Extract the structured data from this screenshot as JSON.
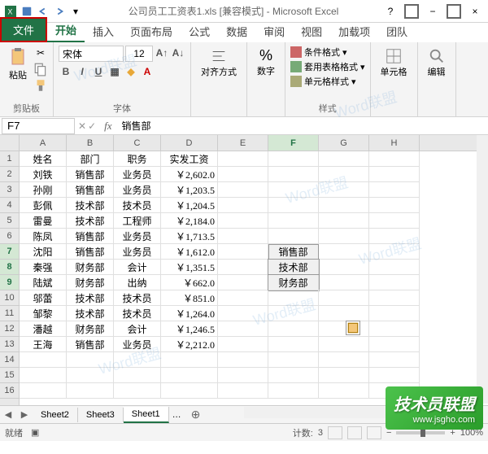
{
  "title": "公司员工工资表1.xls [兼容模式] - Microsoft Excel",
  "ribbon": {
    "file": "文件",
    "tabs": [
      "开始",
      "插入",
      "页面布局",
      "公式",
      "数据",
      "审阅",
      "视图",
      "加载项",
      "团队"
    ],
    "active_tab": 0,
    "clipboard": {
      "paste": "粘贴",
      "label": "剪贴板"
    },
    "font": {
      "name": "宋体",
      "size": "12",
      "label": "字体"
    },
    "align": {
      "label": "对齐方式"
    },
    "number": {
      "label": "数字",
      "pct": "%"
    },
    "styles": {
      "cond": "条件格式",
      "table": "套用表格格式",
      "cell": "单元格样式",
      "label": "样式"
    },
    "cells": {
      "label": "单元格"
    },
    "editing": {
      "label": "编辑"
    }
  },
  "name_box": "F7",
  "formula": "销售部",
  "columns": [
    "A",
    "B",
    "C",
    "D",
    "E",
    "F",
    "G",
    "H"
  ],
  "selected_col": "F",
  "selected_rows": [
    7,
    8,
    9
  ],
  "header_row": [
    "姓名",
    "部门",
    "职务",
    "实发工资"
  ],
  "rows": [
    [
      "刘铁",
      "销售部",
      "业务员",
      "￥2,602.0"
    ],
    [
      "孙刚",
      "销售部",
      "业务员",
      "￥1,203.5"
    ],
    [
      "彭佩",
      "技术部",
      "技术员",
      "￥1,204.5"
    ],
    [
      "雷曼",
      "技术部",
      "工程师",
      "￥2,184.0"
    ],
    [
      "陈凤",
      "销售部",
      "业务员",
      "￥1,713.5"
    ],
    [
      "沈阳",
      "销售部",
      "业务员",
      "￥1,612.0"
    ],
    [
      "秦强",
      "财务部",
      "会计",
      "￥1,351.5"
    ],
    [
      "陆斌",
      "财务部",
      "出纳",
      "￥662.0"
    ],
    [
      "邬蕾",
      "技术部",
      "技术员",
      "￥851.0"
    ],
    [
      "邹黎",
      "技术部",
      "技术员",
      "￥1,264.0"
    ],
    [
      "潘越",
      "财务部",
      "会计",
      "￥1,246.5"
    ],
    [
      "王海",
      "销售部",
      "业务员",
      "￥2,212.0"
    ]
  ],
  "f_range": [
    "销售部",
    "技术部",
    "财务部"
  ],
  "sheets": [
    "Sheet2",
    "Sheet3",
    "Sheet1"
  ],
  "active_sheet": 2,
  "status": {
    "ready": "就绪",
    "count_label": "计数:",
    "count": "3",
    "zoom": "100%"
  },
  "watermark": "Word联盟",
  "brand": {
    "text": "技术员联盟",
    "url": "www.jsgho.com"
  }
}
